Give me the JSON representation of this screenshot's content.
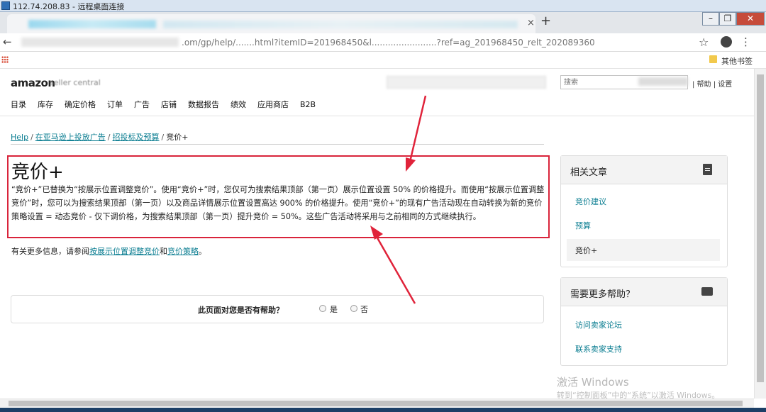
{
  "rdp": {
    "title": "112.74.208.83 - 远程桌面连接"
  },
  "browser": {
    "tab_close": "×",
    "new_tab": "+",
    "win_min": "–",
    "win_max": "❐",
    "win_close": "✕",
    "back": "←",
    "url_visible": ".om/gp/help/.......html?itemID=201968450&l........................?ref=ag_201968450_relt_202089360",
    "star": "☆",
    "menu": "⋮",
    "bookmark_other": "其他书签"
  },
  "header": {
    "logo": "amazon",
    "logo_sub": "seller central",
    "search_placeholder": "搜索",
    "help_links": "| 帮助 | 设置"
  },
  "nav": {
    "items": [
      "目录",
      "库存",
      "确定价格",
      "订单",
      "广告",
      "店铺",
      "数据报告",
      "绩效",
      "应用商店",
      "B2B"
    ]
  },
  "breadcrumb": {
    "items": [
      "Help",
      "在亚马逊上投放广告",
      "招投标及预算"
    ],
    "current": "竞价+",
    "sep": "/"
  },
  "article": {
    "title": "竞价+",
    "body": "“竞价+”已替换为“按展示位置调整竞价”。使用“竞价+”时，您仅可为搜索结果顶部（第一页）展示位置设置 50% 的价格提升。而使用“按展示位置调整竞价”时，您可以为搜索结果顶部（第一页）以及商品详情展示位置设置高达 900% 的价格提升。使用“竞价+”的现有广告活动现在自动转换为新的竞价策略设置 = 动态竞价 - 仅下调价格，为搜索结果顶部（第一页）提升竞价 = 50%。这些广告活动将采用与之前相同的方式继续执行。",
    "more_prefix": "有关更多信息，请参阅",
    "more_link1": "按展示位置调整竞价",
    "more_and": "和",
    "more_link2": "竞价策略",
    "more_suffix": "。"
  },
  "feedback": {
    "question": "此页面对您是否有帮助？",
    "yes": "是",
    "no": "否"
  },
  "sidebar": {
    "related": {
      "title": "相关文章",
      "links": [
        "竞价建议",
        "预算"
      ],
      "current": "竞价+"
    },
    "help": {
      "title": "需要更多帮助？",
      "links": [
        "访问卖家论坛",
        "联系卖家支持"
      ]
    }
  },
  "watermark": {
    "line1": "激活 Windows",
    "line2": "转到“控制面板”中的“系统”以激活 Windows。"
  },
  "colors": {
    "link": "#0a7d91",
    "highlight": "#d9243b"
  }
}
